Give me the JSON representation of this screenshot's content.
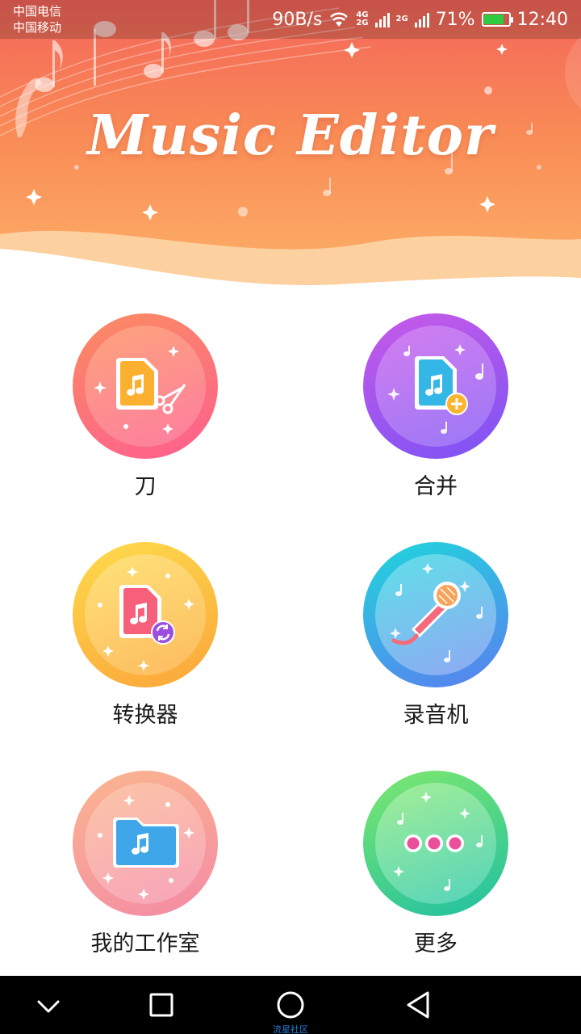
{
  "status_bar": {
    "carrier_1": "中国电信",
    "carrier_2": "中国移动",
    "net_speed": "90B/s",
    "net_type_a_top": "4G",
    "net_type_a_bottom": "2G",
    "net_type_b": "2G",
    "battery": "71%",
    "time": "12:40"
  },
  "header": {
    "title": "Music Editor"
  },
  "features": [
    {
      "label": "刀",
      "icon": "cut-music-file-icon"
    },
    {
      "label": "合并",
      "icon": "merge-music-file-icon"
    },
    {
      "label": "转换器",
      "icon": "convert-music-file-icon"
    },
    {
      "label": "录音机",
      "icon": "microphone-icon"
    },
    {
      "label": "我的工作室",
      "icon": "music-folder-icon"
    },
    {
      "label": "更多",
      "icon": "more-dots-icon"
    }
  ],
  "colors": {
    "header_top": "#f4655a",
    "header_bottom": "#fdb46a",
    "cut_ring": "#f86d86",
    "merge_ring": "#a65bee",
    "convert_ring": "#fbbc3c",
    "recorder_ring": "#38c3e0",
    "studio_ring": "#f4a3a3",
    "more_ring": "#43d29b"
  },
  "navbar": {
    "watermark": "流星社区"
  }
}
